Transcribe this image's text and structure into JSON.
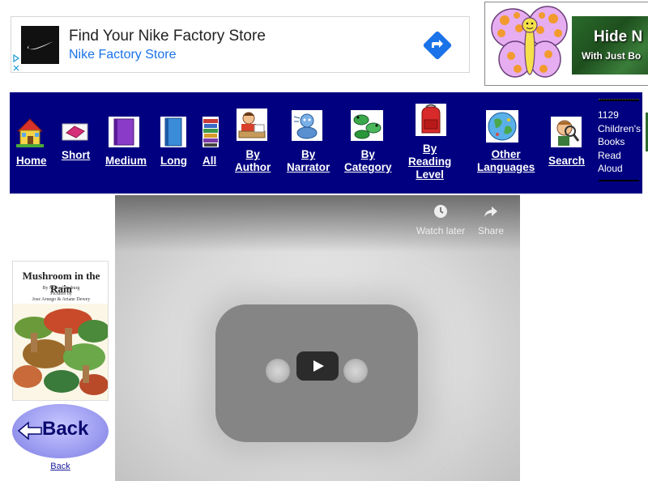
{
  "ad": {
    "title": "Find Your Nike Factory Store",
    "subtitle": "Nike Factory Store"
  },
  "side_ad": {
    "title": "Hide N",
    "subtitle": "With Just Bo"
  },
  "nav": {
    "items": [
      {
        "label": "Home",
        "icon": "house-icon"
      },
      {
        "label": "Short",
        "icon": "pink-book-icon"
      },
      {
        "label": "Medium",
        "icon": "purple-book-icon"
      },
      {
        "label": "Long",
        "icon": "blue-book-icon"
      },
      {
        "label": "All",
        "icon": "book-stack-icon"
      },
      {
        "label_line1": "By",
        "label_line2": "Author",
        "icon": "author-icon"
      },
      {
        "label_line1": "By",
        "label_line2": "Narrator",
        "icon": "narrator-icon"
      },
      {
        "label_line1": "By",
        "label_line2": "Category",
        "icon": "frogs-icon"
      },
      {
        "label_line1": "By",
        "label_line2": "Reading",
        "label_line3": "Level",
        "icon": "backpack-icon"
      },
      {
        "label_line1": "Other",
        "label_line2": "Languages",
        "icon": "globe-icon"
      },
      {
        "label": "Search",
        "icon": "magnifier-kid-icon"
      }
    ],
    "books_count": [
      "1129",
      "Children's",
      "Books",
      "Read",
      "Aloud"
    ]
  },
  "video": {
    "watch_later": "Watch later",
    "share": "Share"
  },
  "book": {
    "title": "Mushroom in the Rain",
    "author_line1": "By Mirra Ginsburg",
    "author_line2": "Pictures by",
    "author_line3": "Jose Aruego & Ariane Dewey"
  },
  "back": {
    "button_label": "Back",
    "link_label": "Back"
  }
}
